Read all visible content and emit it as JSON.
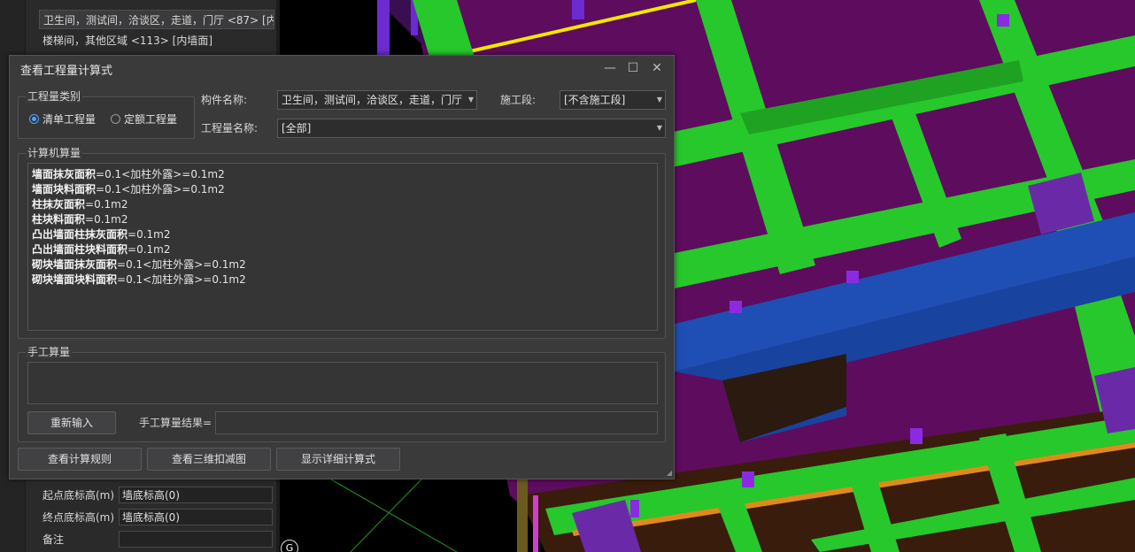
{
  "left_panel": {
    "list_items": [
      "卫生间，测试间，洽谈区，走道，门厅 <87> [内",
      "楼梯间，其他区域 <113> [内墙面]"
    ],
    "properties": [
      {
        "label": "起点底标高(m)",
        "value": "墙底标高(0)"
      },
      {
        "label": "终点底标高(m)",
        "value": "墙底标高(0)"
      },
      {
        "label": "备注",
        "value": ""
      }
    ]
  },
  "viewport": {
    "axis_label": "G",
    "colors": {
      "background": "#000000",
      "floor": "#5e0c5e",
      "beam": "#27c82b",
      "blue_beam": "#1f4fb5",
      "column": "#6a2aa8",
      "brown": "#3a1c0c",
      "orange": "#e08a1e",
      "yellow": "#f2e600"
    }
  },
  "dialog": {
    "title": "查看工程量计算式",
    "window_buttons": {
      "minimize": "—",
      "maximize": "☐",
      "close": "✕"
    },
    "category_group": {
      "title": "工程量类别",
      "options": [
        {
          "label": "清单工程量",
          "selected": true
        },
        {
          "label": "定额工程量",
          "selected": false
        }
      ]
    },
    "component_name": {
      "label": "构件名称:",
      "value": "卫生间，测试间，洽谈区，走道，门厅"
    },
    "construction_stage": {
      "label": "施工段:",
      "value": "[不含施工段]"
    },
    "quantity_name": {
      "label": "工程量名称:",
      "value": "[全部]"
    },
    "computer_calc": {
      "title": "计算机算量",
      "lines": [
        {
          "name": "墙面抹灰面积",
          "expr": "=0.1<加柱外露>=0.1m2"
        },
        {
          "name": "墙面块料面积",
          "expr": "=0.1<加柱外露>=0.1m2"
        },
        {
          "name": "柱抹灰面积",
          "expr": "=0.1m2"
        },
        {
          "name": "柱块料面积",
          "expr": "=0.1m2"
        },
        {
          "name": "凸出墙面柱抹灰面积",
          "expr": "=0.1m2"
        },
        {
          "name": "凸出墙面柱块料面积",
          "expr": "=0.1m2"
        },
        {
          "name": "砌块墙面抹灰面积",
          "expr": "=0.1<加柱外露>=0.1m2"
        },
        {
          "name": "砌块墙面块料面积",
          "expr": "=0.1<加柱外露>=0.1m2"
        }
      ]
    },
    "manual_calc": {
      "title": "手工算量",
      "reenter_label": "重新输入",
      "result_label": "手工算量结果=",
      "result_value": ""
    },
    "bottom_buttons": {
      "rules": "查看计算规则",
      "deduct_3d": "查看三维扣减图",
      "detail": "显示详细计算式"
    }
  }
}
